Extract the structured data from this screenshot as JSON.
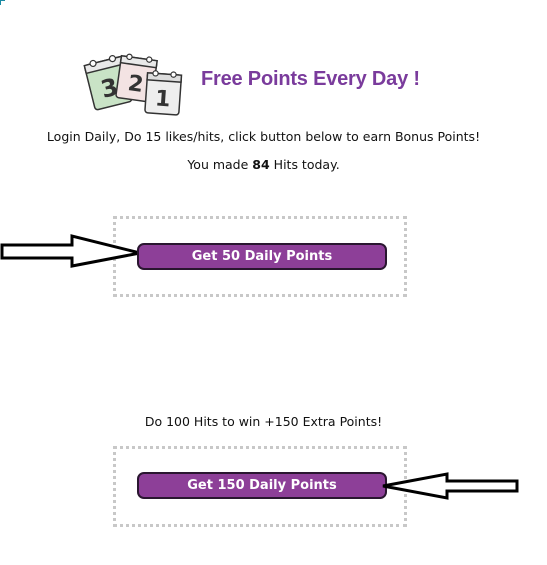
{
  "header": {
    "title": "Free Points Every Day !"
  },
  "icons": {
    "calendar": "calendar-pages-icon",
    "arrow_left": "arrow-pointing-right-icon",
    "arrow_right": "arrow-pointing-left-icon"
  },
  "calendar_digits": [
    "3",
    "2",
    "1"
  ],
  "info": {
    "instructions": "Login Daily, Do 15 likes/hits, click button below to earn Bonus Points!",
    "hits_prefix": "You made ",
    "hits_count": "84",
    "hits_suffix": " Hits today.",
    "extra_offer": "Do 100 Hits to win +150 Extra Points!"
  },
  "buttons": {
    "daily_50": "Get 50 Daily Points",
    "daily_150": "Get 150 Daily Points"
  },
  "colors": {
    "title_purple": "#7a3b9c",
    "button_purple": "#8d3f98",
    "button_border": "#2a1630",
    "dotted_border": "#c8c8c8"
  }
}
